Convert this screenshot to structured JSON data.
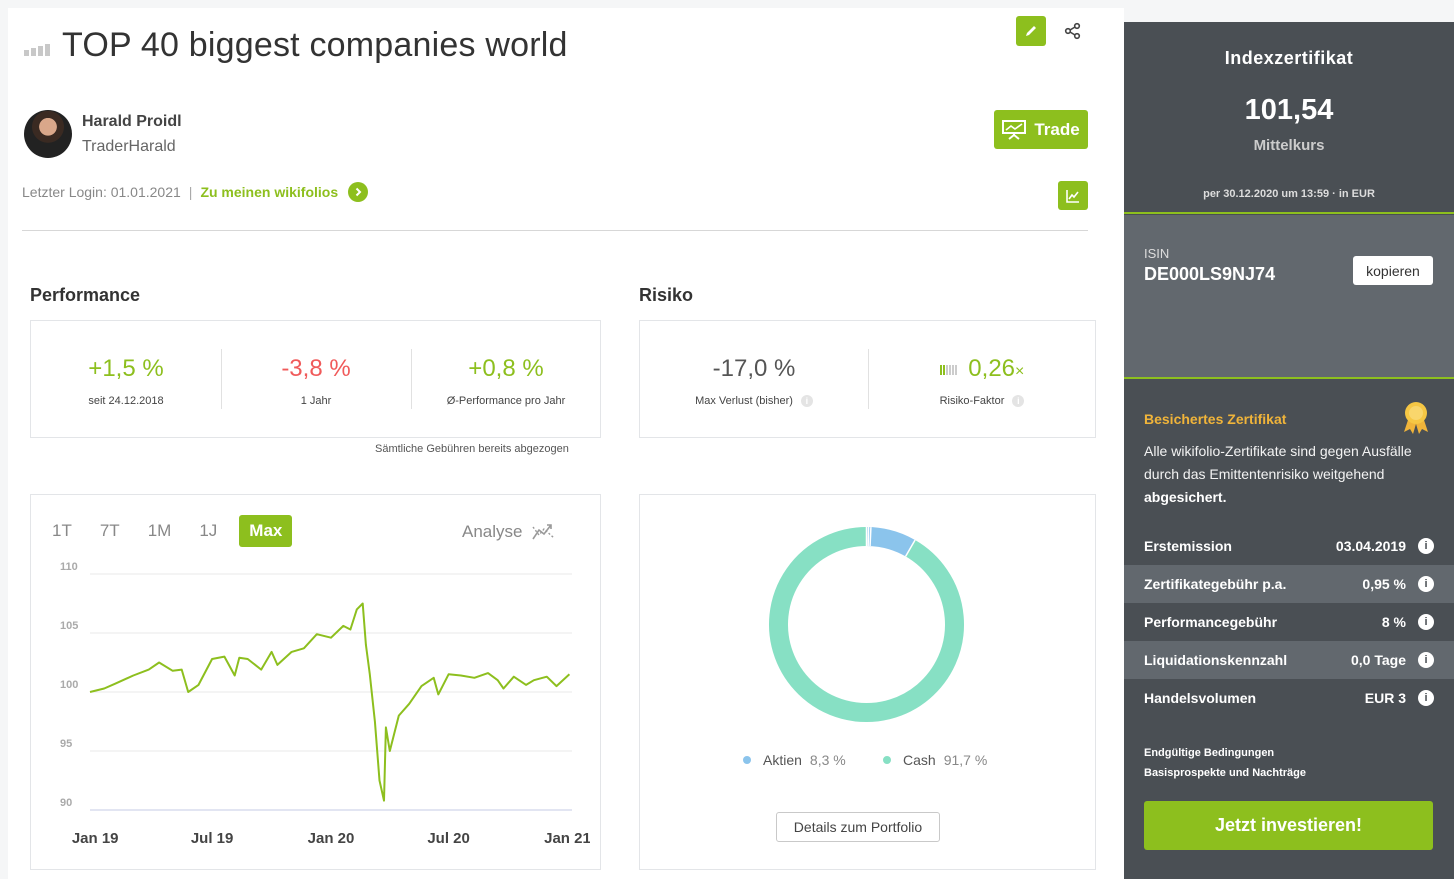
{
  "header": {
    "title": "TOP 40 biggest companies world"
  },
  "author": {
    "name": "Harald Proidl",
    "nickname": "TraderHarald",
    "last_login_label": "Letzter Login: 01.01.2021",
    "separator": "|",
    "wikifolios_link": "Zu meinen wikifolios"
  },
  "actions": {
    "trade_label": "Trade"
  },
  "performance": {
    "section_title": "Performance",
    "kpis": [
      {
        "value": "+1,5 %",
        "label": "seit 24.12.2018"
      },
      {
        "value": "-3,8 %",
        "label": "1 Jahr"
      },
      {
        "value": "+0,8 %",
        "label": "Ø-Performance pro Jahr"
      }
    ],
    "fees_note": "Sämtliche Gebühren bereits abgezogen"
  },
  "risk": {
    "section_title": "Risiko",
    "max_loss": {
      "value": "-17,0 %",
      "label": "Max Verlust (bisher)"
    },
    "risk_factor": {
      "value": "0,26",
      "suffix": "×",
      "label": "Risiko-Faktor"
    },
    "info_glyph": "i"
  },
  "chart_controls": {
    "ranges": [
      "1T",
      "7T",
      "1M",
      "1J",
      "Max"
    ],
    "active_range": "Max",
    "analyse_label": "Analyse"
  },
  "chart_data": [
    {
      "type": "line",
      "title": "",
      "xlabel": "",
      "ylabel": "",
      "ylim": [
        90,
        110
      ],
      "yticks": [
        110,
        105,
        100,
        95,
        90
      ],
      "xtick_labels": [
        "Jan 19",
        "Jul 19",
        "Jan 20",
        "Jul 20",
        "Jan 21"
      ],
      "xticks": [
        "2019-01-01",
        "2019-07-01",
        "2020-01-01",
        "2020-07-01",
        "2021-01-01"
      ],
      "xlim": [
        "2018-12-24",
        "2021-01-08"
      ],
      "grid": true,
      "color": "#8dbf1e",
      "series": [
        {
          "x": [
            "2018-12-24",
            "2019-01-15",
            "2019-02-01",
            "2019-03-01",
            "2019-03-25",
            "2019-04-10",
            "2019-05-01",
            "2019-05-15",
            "2019-05-25",
            "2019-06-10",
            "2019-07-01",
            "2019-07-20",
            "2019-08-05",
            "2019-08-12",
            "2019-08-25",
            "2019-09-15",
            "2019-10-01",
            "2019-10-10",
            "2019-11-01",
            "2019-11-20",
            "2019-12-10",
            "2020-01-01",
            "2020-01-20",
            "2020-01-31",
            "2020-02-10",
            "2020-02-19",
            "2020-02-24",
            "2020-03-01",
            "2020-03-09",
            "2020-03-16",
            "2020-03-23",
            "2020-03-26",
            "2020-04-01",
            "2020-04-15",
            "2020-05-01",
            "2020-05-20",
            "2020-06-08",
            "2020-06-15",
            "2020-07-01",
            "2020-07-20",
            "2020-08-10",
            "2020-08-31",
            "2020-09-15",
            "2020-09-24",
            "2020-10-10",
            "2020-10-29",
            "2020-11-10",
            "2020-11-30",
            "2020-12-15",
            "2021-01-04"
          ],
          "y": [
            100.0,
            100.3,
            100.7,
            101.4,
            101.9,
            102.5,
            101.8,
            101.9,
            100.0,
            100.6,
            102.8,
            103.0,
            101.4,
            102.9,
            102.8,
            101.9,
            103.4,
            102.3,
            103.4,
            103.7,
            104.9,
            104.6,
            105.6,
            105.3,
            107.0,
            107.5,
            104.0,
            101.5,
            97.5,
            92.5,
            90.8,
            97.0,
            95.0,
            98.0,
            99.0,
            100.5,
            101.2,
            99.8,
            101.5,
            101.4,
            101.2,
            101.6,
            101.0,
            100.3,
            101.3,
            100.6,
            101.0,
            101.3,
            100.5,
            101.5
          ]
        }
      ]
    },
    {
      "type": "pie",
      "donut": true,
      "categories": [
        "Aktien",
        "Cash"
      ],
      "values": [
        8.3,
        91.7
      ],
      "colors": [
        "#8bc4ec",
        "#87e0c4"
      ],
      "value_labels": [
        "8,3 %",
        "91,7 %"
      ]
    }
  ],
  "portfolio": {
    "details_label": "Details zum Portfolio"
  },
  "sidebar": {
    "type_title": "Indexzertifikat",
    "price": "101,54",
    "price_label": "Mittelkurs",
    "as_of": "per 30.12.2020 um 13:59 · in EUR",
    "isin_label": "ISIN",
    "isin": "DE000LS9NJ74",
    "copy_label": "kopieren",
    "secured_title": "Besichertes Zertifikat",
    "secured_text": "Alle wikifolio-Zertifikate sind gegen Ausfälle durch das Emittentenrisiko weitgehend",
    "secured_bold": "abgesichert.",
    "attributes": [
      {
        "key": "Erstemission",
        "value": "03.04.2019"
      },
      {
        "key": "Zertifikategebühr p.a.",
        "value": "0,95 %"
      },
      {
        "key": "Performancegebühr",
        "value": "8 %"
      },
      {
        "key": "Liquidationskennzahl",
        "value": "0,0 Tage"
      },
      {
        "key": "Handelsvolumen",
        "value": "EUR 3"
      }
    ],
    "info_glyph": "i",
    "links": [
      "Endgültige Bedingungen",
      "Basisprospekte und Nachträge"
    ],
    "invest_label": "Jetzt investieren!"
  },
  "colors": {
    "accent": "#8dbf1e",
    "negative": "#f05a5a",
    "sidebar": "#4a4f54",
    "sidebar_alt": "#62686e",
    "badge": "#f0b43a"
  },
  "icons": [
    "bar-chart-icon",
    "pencil-icon",
    "share-icon",
    "presentation-icon",
    "chevron-right-icon",
    "line-chart-icon",
    "analyse-icon",
    "info-icon",
    "medal-icon",
    "risk-bars-icon"
  ]
}
